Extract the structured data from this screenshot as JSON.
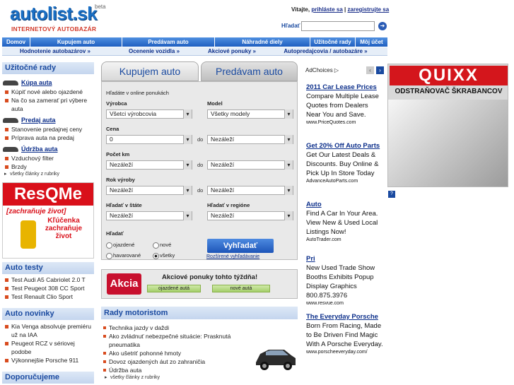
{
  "header": {
    "logo": "autolist.sk",
    "beta": "beta",
    "tagline": "INTERNETOVÝ AUTOBAZÁR",
    "welcome": "Vitajte,",
    "login_link": "prihláste sa",
    "separator": "|",
    "register_link": "zaregistrujte sa",
    "search_label": "Hľadať"
  },
  "nav": [
    "Domov",
    "Kupujem auto",
    "Predávam auto",
    "Náhradné diely",
    "Užitočné rady",
    "Môj účet"
  ],
  "subnav": [
    "Hodnotenie autobazárov »",
    "Ocenenie vozidla »",
    "Akciové ponuky »",
    "Autopredajcovia / autobazáre »"
  ],
  "left": {
    "uzitocne": "Užitočné rady",
    "kupa": "Kúpa auta",
    "kupa_items": [
      "Kúpiť nové alebo ojazdené",
      "Na čo sa zamerať pri výbere auta"
    ],
    "predaj": "Predaj auta",
    "predaj_items": [
      "Stanovenie predajnej ceny",
      "Príprava auta na predaj"
    ],
    "udrzba": "Údržba auta",
    "udrzba_items": [
      "Vzduchový filter",
      "Brzdy"
    ],
    "more": "všetky články z rubriky",
    "resq_brand": "ResQMe",
    "resq_slogan": "[zachraňuje život]",
    "resq_text": "Kľúčenka zachraňuje život",
    "autotesty": "Auto testy",
    "tests": [
      "Test Audi A5 Cabriolet 2.0 T",
      "Test Peugeot 308 CC Sport",
      "Test Renault Clio Sport"
    ],
    "novinky": "Auto novinky",
    "news": [
      "Kia Venga absolvuje premiéru už na IAA",
      "Peugeot RCZ v sériovej podobe",
      "Výkonnejšie Porsche 911"
    ],
    "doporucujeme": "Doporučujeme"
  },
  "search": {
    "tab_buy": "Kupujem auto",
    "tab_sell": "Predávam auto",
    "subtitle": "Hľadáte v online ponukách",
    "vyrobca_label": "Výrobca",
    "vyrobca_value": "Všetci výrobcovia",
    "model_label": "Model",
    "model_value": "Všetky modely",
    "cena_label": "Cena",
    "cena_from": "0",
    "do": "do",
    "nezalezi": "Nezáleží",
    "km_label": "Počet km",
    "rok_label": "Rok výroby",
    "stat_label": "Hľadať v štáte",
    "region_label": "Hľadať v regióne",
    "hladat_label": "Hľadať",
    "r_ojazdene": "ojazdené",
    "r_nove": "nové",
    "r_havarovane": "havarované",
    "r_vsetky": "všetky",
    "submit": "Vyhľadať",
    "advanced": "Rozšírené vyhľadávanie"
  },
  "akcia": {
    "badge": "Akcia",
    "title": "Akciové ponuky tohto týždňa!",
    "btn_used": "ojazdené autá",
    "btn_new": "nové autá"
  },
  "rady": {
    "title": "Rady motoristom",
    "items": [
      "Technika jazdy v daždi",
      "Ako zvládnuť nebezpečné situácie: Prasknutá pneumatika",
      "Ako ušetriť pohonné hmoty",
      "Dovoz ojazdených áut zo zahraničia",
      "Údržba auta"
    ],
    "more": "všetky články z rubriky"
  },
  "ads": {
    "adchoices": "AdChoices ▷",
    "items": [
      {
        "title": "2011 Car Lease Prices",
        "desc": "Compare Multiple Lease Quotes from Dealers Near You and Save.",
        "url": "www.PriceQuotes.com"
      },
      {
        "title": "Get 20% Off Auto Parts",
        "desc": "Get Our Latest Deals & Discounts. Buy Online & Pick Up In Store Today",
        "url": "AdvanceAutoParts.com"
      },
      {
        "title": "Auto",
        "desc": "Find A Car In Your Area. View New & Used Local Listings Now!",
        "url": "AutoTrader.com"
      },
      {
        "title": "Pri",
        "desc": "New Used Trade Show Booths Exhibits Popup Display Graphics 800.875.3976",
        "url": "www.resvue.com"
      },
      {
        "title": "The Everyday Porsche",
        "desc": "Born From Racing, Made to Be Driven Find Magic With A Porsche Everyday.",
        "url": "www.porscheeveryday.com/"
      }
    ],
    "quixx_logo": "QUIXX",
    "quixx_sub": "ODSTRAŇOVAČ ŠKRABANCOV"
  }
}
